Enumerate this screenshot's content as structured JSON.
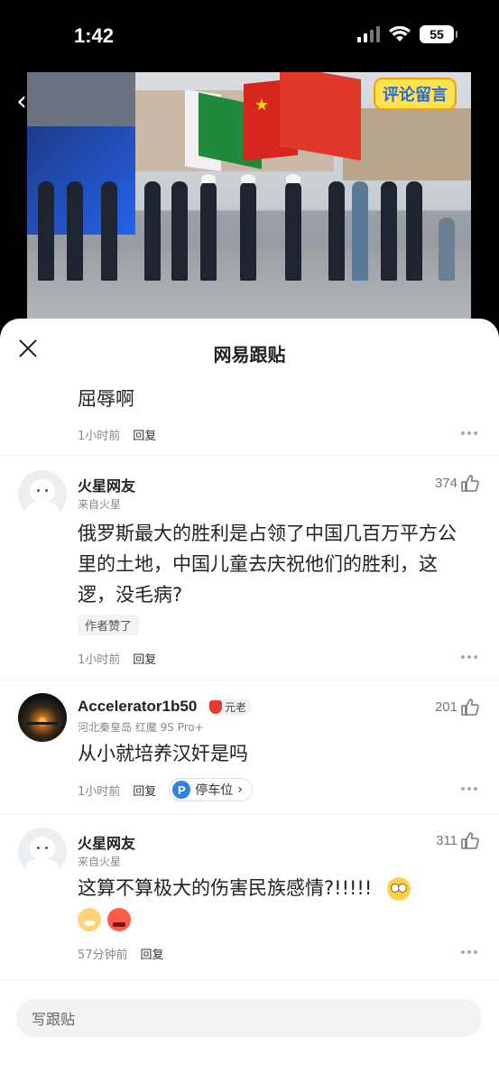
{
  "status_bar": {
    "time": "1:42",
    "battery": "55"
  },
  "video": {
    "badge_text": "评论留言"
  },
  "sheet": {
    "title": "网易跟贴"
  },
  "comments": [
    {
      "body": "屈辱啊",
      "time": "1小时前",
      "reply_label": "回复"
    },
    {
      "name": "火星网友",
      "subtitle": "来自火星",
      "likes": "374",
      "body": "俄罗斯最大的胜利是占领了中国几百万平方公里的土地，中国儿童去庆祝他们的胜利，这逻，没毛病?",
      "author_like": "作者赞了",
      "time": "1小时前",
      "reply_label": "回复"
    },
    {
      "name": "Accelerator1b50",
      "badge": "元老",
      "subtitle": "河北秦皇岛  红魔 9S Pro+",
      "likes": "201",
      "body": "从小就培养汉奸是吗",
      "time": "1小时前",
      "reply_label": "回复",
      "chip": "停车位"
    },
    {
      "name": "火星网友",
      "subtitle": "来自火星",
      "likes": "311",
      "body": "这算不算极大的伤害民族感情?!!!!!",
      "time": "57分钟前",
      "reply_label": "回复"
    }
  ],
  "composer": {
    "placeholder": "写跟贴"
  }
}
